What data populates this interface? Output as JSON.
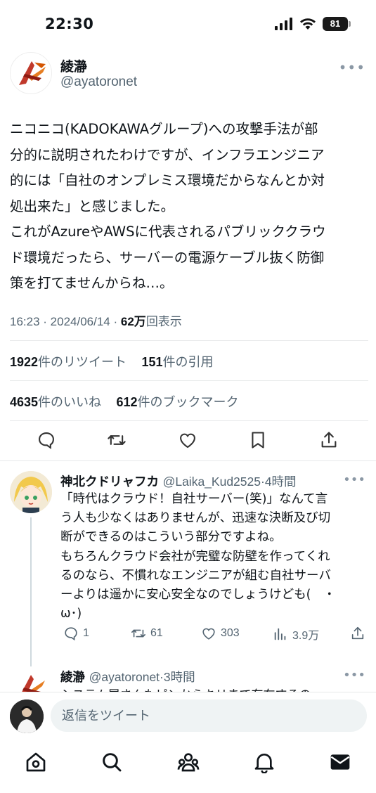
{
  "status_bar": {
    "time": "22:30",
    "battery": "81"
  },
  "tweet": {
    "author_name": "綾瀞",
    "author_handle": "@ayatoronet",
    "text": "ニコニコ(KADOKAWAグループ)への攻撃手法が部\n分的に説明されたわけですが、インフラエンジニア\n的には「自社のオンプレミス環境だからなんとか対\n処出来た」と感じました。\nこれがAzureやAWSに代表されるパブリッククラウ\nド環境だったら、サーバーの電源ケーブル抜く防御\n策を打てませんからね…。",
    "time": "16:23",
    "date": "2024/06/14",
    "views_count": "62万",
    "views_label": "回表示",
    "retweets_count": "1922",
    "retweets_label": "件のリツイート",
    "quotes_count": "151",
    "quotes_label": "件の引用",
    "likes_count": "4635",
    "likes_label": "件のいいね",
    "bookmarks_count": "612",
    "bookmarks_label": "件のブックマーク"
  },
  "reply": {
    "name": "神北クドリャフカ",
    "handle": "@Laika_Kud2525",
    "time": "4時間",
    "text": "「時代はクラウド！自社サーバー(笑)」なんて言\nう人も少なくはありませんが、迅速な決断及び切\n断ができるのはこういう部分ですよね。\nもちろんクラウド会社が完璧な防壁を作ってくれ\nるのなら、不慣れなエンジニアが組む自社サーバ\nーよりは遥かに安心安全なのでしょうけども(　・\nω･)",
    "replies": "1",
    "retweets": "61",
    "likes": "303",
    "views": "3.9万"
  },
  "reply2": {
    "name": "綾瀞",
    "handle": "@ayatoronet",
    "time": "3時間",
    "preview": "システム屋さんもピンからキリまで存在するの"
  },
  "compose": {
    "placeholder": "返信をツイート"
  },
  "icons": {
    "reply": "reply-icon",
    "retweet": "retweet-icon",
    "like": "heart-icon",
    "bookmark": "bookmark-icon",
    "share": "share-icon",
    "home": "home-icon",
    "search": "search-icon",
    "communities": "communities-icon",
    "notifications": "bell-icon",
    "messages": "mail-icon"
  },
  "colors": {
    "text": "#0f1419",
    "secondary": "#536471",
    "divider": "#e7e9ea",
    "accent": "#c0392b"
  }
}
